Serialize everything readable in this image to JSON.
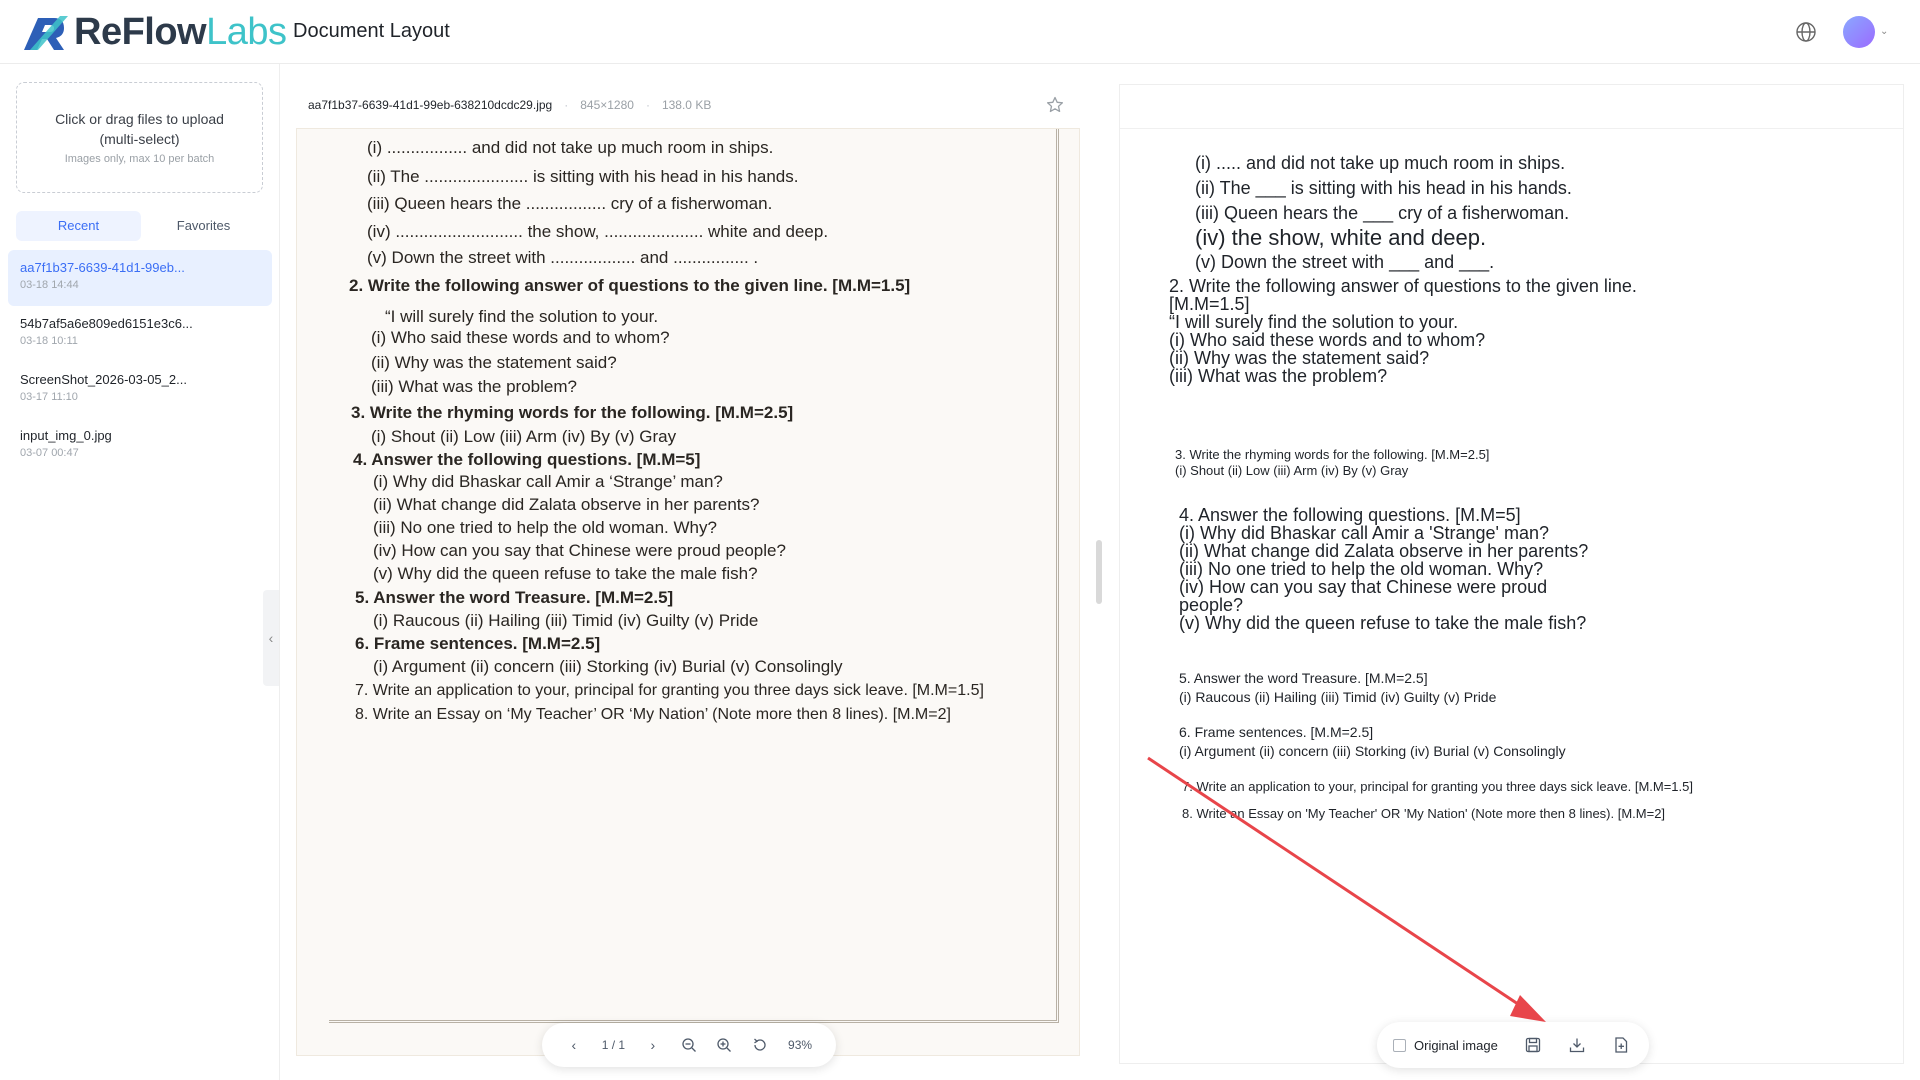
{
  "header": {
    "brand_re": "ReFlow",
    "brand_labs": "Labs",
    "title": "Document Layout"
  },
  "sidebar": {
    "upload_main": "Click or drag files to upload (multi-select)",
    "upload_sub": "Images only, max 10 per batch",
    "tabs": [
      {
        "label": "Recent",
        "active": true
      },
      {
        "label": "Favorites",
        "active": false
      }
    ],
    "files": [
      {
        "name": "aa7f1b37-6639-41d1-99eb...",
        "time": "03-18 14:44"
      },
      {
        "name": "54b7af5a6e809ed6151e3c6...",
        "time": "03-18 10:11"
      },
      {
        "name": "ScreenShot_2026-03-05_2...",
        "time": "03-17 11:10"
      },
      {
        "name": "input_img_0.jpg",
        "time": "03-07 00:47"
      }
    ],
    "collapse_glyph": "‹"
  },
  "viewer": {
    "file_name": "aa7f1b37-6639-41d1-99eb-638210dcdc29.jpg",
    "dimensions": "845×1280",
    "size": "138.0 KB",
    "sep": "·",
    "page_lines": [
      "(i)      ................. and did not take up much room in ships.",
      "(ii)     The ...................... is sitting with his head in his hands.",
      "(iii)    Queen hears the ................. cry of a fisherwoman.",
      "(iv)     ........................... the show, ..................... white and deep.",
      "(v)      Down the street with .................. and ................ .",
      "2.  Write the following answer of questions to the given line. [M.M=1.5]",
      "“I will surely find the solution to your.",
      "(i)      Who said these words and to whom?",
      "(ii)     Why was the statement said?",
      "(iii)    What was the problem?",
      "3.  Write the rhyming words for the following. [M.M=2.5]",
      "(i)      Shout     (ii) Low     (iii) Arm     (iv) By     (v) Gray",
      "4.  Answer the following questions. [M.M=5]",
      "(i)      Why did Bhaskar call Amir a ‘Strange’ man?",
      "(ii)     What change did Zalata observe in her parents?",
      "(iii)    No one tried to help the old woman. Why?",
      "(iv)     How can you say that Chinese were proud people?",
      "(v)      Why did the queen refuse to take the male fish?",
      "5.  Answer the word Treasure. [M.M=2.5]",
      "(i)      Raucous    (ii) Hailing    (iii) Timid    (iv) Guilty    (v) Pride",
      "6.  Frame sentences. [M.M=2.5]",
      "(i)      Argument   (ii) concern   (iii) Storking   (iv) Burial   (v) Consolingly",
      "7.  Write an application to your, principal for granting you three days sick leave. [M.M=1.5]",
      "8.  Write an Essay on ‘My Teacher’ OR  ‘My Nation’ (Note more then 8 lines).          [M.M=2]"
    ],
    "pager": {
      "page": "1 / 1",
      "zoom": "93%"
    }
  },
  "result": {
    "lines": [
      "(i) ..... and did not take up much room in ships.",
      "(ii) The ___ is sitting with his head in his hands.",
      "(iii) Queen hears the ___ cry of a fisherwoman.",
      "(iv) the show, white and deep.",
      "(v) Down the street with ___ and ___.",
      "2. Write the following answer of questions to the given line.",
      "[M.M=1.5]",
      "“I will surely find the solution to your.",
      "(i) Who said these words and to whom?",
      "(ii) Why was the statement said?",
      "(iii) What was the problem?",
      "3. Write the rhyming words for the following. [M.M=2.5]",
      "(i) Shout (ii) Low (iii) Arm (iv) By (v) Gray",
      "4. Answer the following questions. [M.M=5]",
      "(i) Why did Bhaskar call Amir a 'Strange' man?",
      "(ii) What change did Zalata observe in her parents?",
      "(iii) No one tried to help the old woman. Why?",
      "(iv) How can you say that Chinese were proud",
      "people?",
      "(v) Why did the queen refuse to take the male fish?",
      "5. Answer the word Treasure. [M.M=2.5]",
      "(i) Raucous (ii) Hailing (iii) Timid (iv) Guilty (v) Pride",
      "6. Frame sentences. [M.M=2.5]",
      "(i) Argument (ii) concern (iii) Storking (iv) Burial (v) Consolingly",
      "7. Write an application to your, principal for granting you three days sick leave. [M.M=1.5]",
      "8. Write an Essay on 'My Teacher' OR 'My Nation' (Note more then 8 lines). [M.M=2]"
    ],
    "original_image_label": "Original image"
  },
  "colors": {
    "accent": "#3b6ef5",
    "brand_teal": "#3ec3c9",
    "annotation_arrow": "#e8454a"
  }
}
